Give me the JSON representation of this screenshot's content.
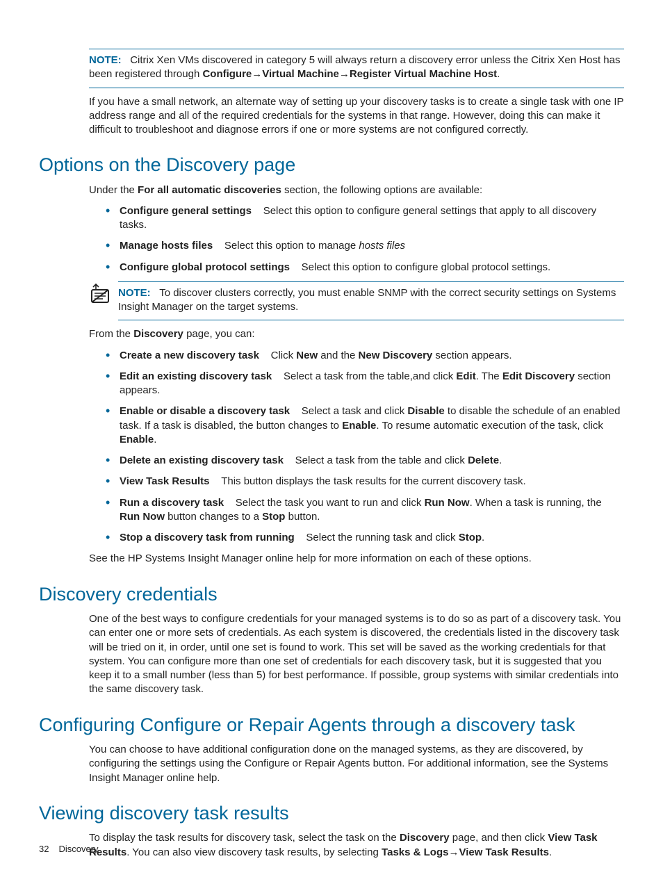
{
  "top_note": {
    "prefix": "NOTE:",
    "text_a": "Citrix Xen VMs discovered in category 5 will always return a discovery error unless the Citrix Xen Host has been registered through ",
    "path_a": "Configure",
    "arrow": "→",
    "path_b": "Virtual Machine",
    "path_c": "Register Virtual Machine Host",
    "trail": "."
  },
  "para_small_network": "If you have a small network, an alternate way of setting up your discovery tasks is to create a single task with one IP address range and all of the required credentials for the systems in that range. However, doing this can make it difficult to troubleshoot and diagnose errors if one or more systems are not configured correctly.",
  "h_options": "Options on the Discovery page",
  "options_intro_a": "Under the ",
  "options_intro_b": "For all automatic discoveries",
  "options_intro_c": " section, the following options are available:",
  "options_list": [
    {
      "title": "Configure general settings",
      "desc": "Select this option to configure general settings that apply to all discovery tasks."
    },
    {
      "title": "Manage hosts files",
      "desc_a": "Select this option to manage ",
      "italic": "hosts files"
    },
    {
      "title": "Configure global protocol settings",
      "desc": "Select this option to configure global protocol settings."
    }
  ],
  "cluster_note": {
    "prefix": "NOTE:",
    "text": "To discover clusters correctly, you must enable SNMP with the correct security settings on Systems Insight Manager on the target systems."
  },
  "from_discovery_a": "From the ",
  "from_discovery_b": "Discovery",
  "from_discovery_c": " page, you can:",
  "actions": [
    {
      "title": "Create a new discovery task",
      "p1": "Click ",
      "b1": "New",
      "p2": " and the ",
      "b2": "New Discovery",
      "p3": " section appears."
    },
    {
      "title": "Edit an existing discovery task",
      "p1": "Select a task from the table,and click ",
      "b1": "Edit",
      "p2": ". The ",
      "b2": "Edit Discovery",
      "p3": " section appears."
    },
    {
      "title": "Enable or disable a discovery task",
      "p1": "Select a task and click ",
      "b1": "Disable",
      "p2": " to disable the schedule of an enabled task. If a task is disabled, the button changes to ",
      "b2": "Enable",
      "p3": ". To resume automatic execution of the task, click ",
      "b3": "Enable",
      "p4": "."
    },
    {
      "title": "Delete an existing discovery task",
      "p1": "Select a task from the table and click ",
      "b1": "Delete",
      "p2": "."
    },
    {
      "title": "View Task Results",
      "p1": "This button displays the task results for the current discovery task."
    },
    {
      "title": "Run a discovery task",
      "p1": "Select the task you want to run and click ",
      "b1": "Run Now",
      "p2": ". When a task is running, the ",
      "b2": "Run Now",
      "p3": " button changes to a ",
      "b3": "Stop",
      "p4": " button."
    },
    {
      "title": "Stop a discovery task from running",
      "p1": "Select the running task and click ",
      "b1": "Stop",
      "p2": "."
    }
  ],
  "see_help": "See the HP Systems Insight Manager online help for more information on each of these options.",
  "h_credentials": "Discovery credentials",
  "credentials_para": "One of the best ways to configure credentials for your managed systems is to do so as part of a discovery task. You can enter one or more sets of credentials. As each system is discovered, the credentials listed in the discovery task will be tried on it, in order, until one set is found to work. This set will be saved as the working credentials for that system. You can configure more than one set of credentials for each discovery task, but it is suggested that you keep it to a small number (less than 5) for best performance. If possible, group systems with similar credentials into the same discovery task.",
  "h_configure": "Configuring Configure or Repair Agents through a discovery task",
  "configure_para": "You can choose to have additional configuration done on the managed systems, as they are discovered, by configuring the settings using the Configure or Repair Agents button. For additional information, see the Systems Insight Manager online help.",
  "h_viewing": "Viewing discovery task results",
  "viewing": {
    "a": "To display the task results for discovery task, select the task on the ",
    "b": "Discovery",
    "c": " page, and then click ",
    "d": "View Task Results",
    "e": ". You can also view discovery task results, by selecting ",
    "f": "Tasks & Logs",
    "arrow": "→",
    "g": "View Task Results",
    "h": "."
  },
  "footer": {
    "page": "32",
    "section": "Discovery"
  }
}
